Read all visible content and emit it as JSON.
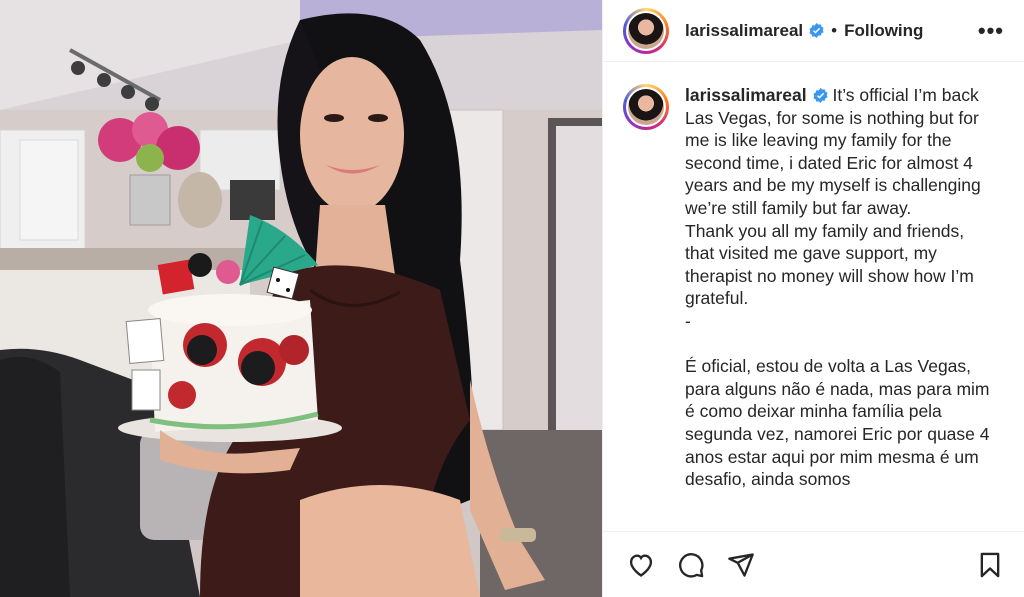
{
  "post": {
    "username": "larissalimareal",
    "follow_status": "Following",
    "separator": "•",
    "more_icon": "more-horizontal-icon",
    "more_glyph": "•••",
    "verified_color": "#3897f0"
  },
  "caption": {
    "username": "larissalimareal",
    "english": "It’s official I’m back Las Vegas, for some is nothing but for me is like leaving my family for the second time, i dated Eric for almost 4 years and be my myself is challenging we’re still family but far away.\nThank you all my family and friends, that visited me gave support, my therapist no money will show how I’m grateful.\n-",
    "portuguese": "É oficial, estou de volta a Las Vegas, para alguns não é nada, mas para mim é como deixar minha família pela segunda vez, namorei Eric por quase 4 anos estar aqui por mim mesma é um desafio, ainda somos"
  },
  "actions": {
    "like_icon": "heart-icon",
    "comment_icon": "comment-icon",
    "share_icon": "send-icon",
    "save_icon": "bookmark-icon"
  }
}
